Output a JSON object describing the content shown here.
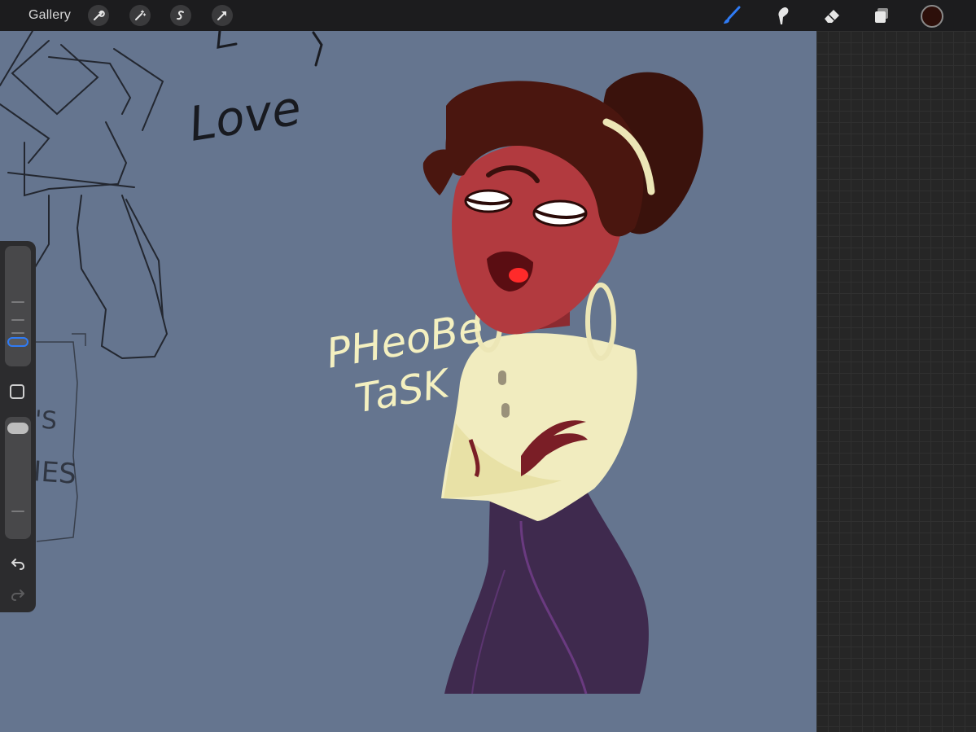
{
  "toolbar": {
    "gallery_label": "Gallery",
    "left_icons": [
      "wrench-icon",
      "magic-wand-icon",
      "selection-s-icon",
      "transform-arrow-icon"
    ],
    "right_icons": [
      "brush-icon",
      "smudge-icon",
      "eraser-icon",
      "layers-icon"
    ],
    "active_tool": "brush",
    "active_color": "#2d0f0a",
    "accent_color": "#2f7bf5"
  },
  "canvas": {
    "background_color": "#65758f",
    "sketch_text": "Love",
    "sketch_fragments": [
      "'S",
      "IES"
    ],
    "character_label_line1": "PHeoBe",
    "character_label_line2": "TaSK"
  },
  "sidebar": {
    "brush_size_level": 0.25,
    "opacity_level": 0.95,
    "undo_icon": "undo-icon",
    "redo_icon": "redo-icon"
  }
}
